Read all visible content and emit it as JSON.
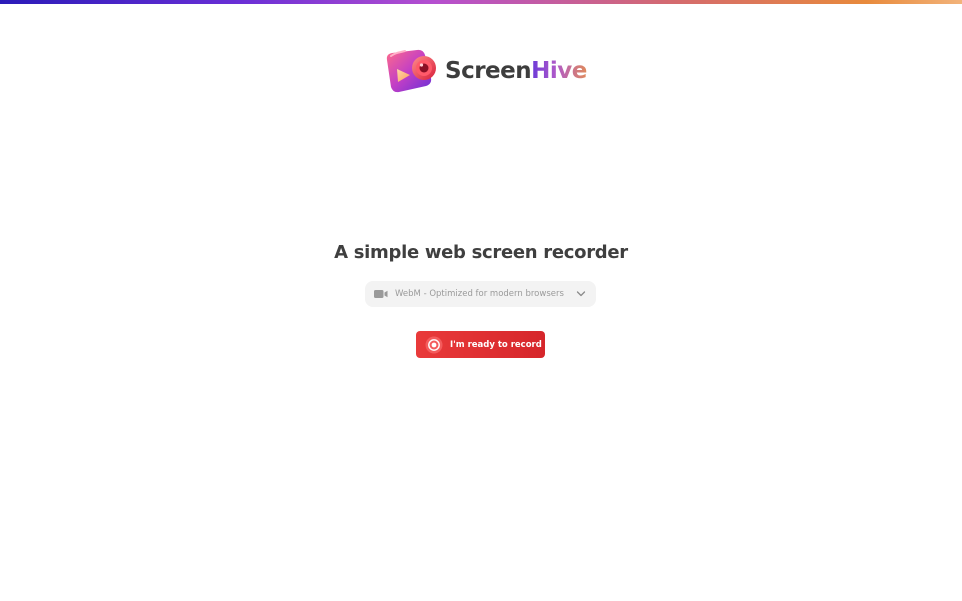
{
  "brand": {
    "name_part1": "Screen",
    "name_part2": "Hive",
    "logo_icon": "camera-icon"
  },
  "hero": {
    "headline": "A simple web screen recorder"
  },
  "format_select": {
    "selected": "WebM - Optimized for modern browsers",
    "icon": "video-camera-icon",
    "dropdown_icon": "chevron-down-icon"
  },
  "record_button": {
    "label": "I'm ready to record",
    "icon": "record-icon"
  },
  "colors": {
    "accent_red": "#e0302f",
    "text_dark": "#3f3f3f",
    "muted": "#9a9a9a",
    "select_bg": "#f3f3f3",
    "brand_purple": "#6b3ad8",
    "brand_orange": "#e08a5a"
  }
}
